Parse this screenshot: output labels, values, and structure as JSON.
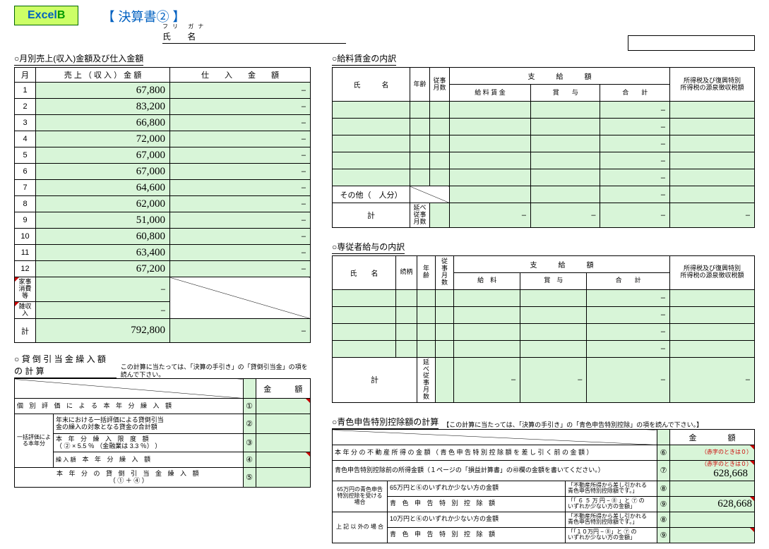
{
  "logo": {
    "part1": "Excel",
    "part2": "B"
  },
  "title": "【 決算書② 】",
  "furigana": "フリ  ガナ",
  "shimei": "氏   名",
  "monthly": {
    "title": "○月別売上(収入)金額及び仕入金額",
    "hdr_month": "月",
    "hdr_sales": "売 上 （ 収 入 ） 金 額",
    "hdr_purchase": "仕　　入　　金　　額",
    "rows": [
      {
        "m": "1",
        "s": "67,800",
        "p": "–"
      },
      {
        "m": "2",
        "s": "83,200",
        "p": "–"
      },
      {
        "m": "3",
        "s": "66,800",
        "p": "–"
      },
      {
        "m": "4",
        "s": "72,000",
        "p": "–"
      },
      {
        "m": "5",
        "s": "67,000",
        "p": "–"
      },
      {
        "m": "6",
        "s": "67,000",
        "p": "–"
      },
      {
        "m": "7",
        "s": "64,600",
        "p": "–"
      },
      {
        "m": "8",
        "s": "62,000",
        "p": "–"
      },
      {
        "m": "9",
        "s": "51,000",
        "p": "–"
      },
      {
        "m": "10",
        "s": "60,800",
        "p": "–"
      },
      {
        "m": "11",
        "s": "63,400",
        "p": "–"
      },
      {
        "m": "12",
        "s": "67,200",
        "p": "–"
      }
    ],
    "kaji": "家事消費等",
    "kaji_val": "–",
    "zatsu": "雑収入",
    "zatsu_val": "–",
    "kei": "計",
    "kei_sales": "792,800",
    "kei_purchase": "–"
  },
  "wages": {
    "title": "○給料賃金の内訳",
    "hdr_name": "氏　　　名",
    "hdr_age": "年齢",
    "hdr_months": "従事月数",
    "hdr_paygroup": "支　　　給　　　額",
    "hdr_pay1": "給 料 賃 金",
    "hdr_pay2": "賞　　与",
    "hdr_pay3": "合　　計",
    "hdr_tax1": "所得税及び復興特別",
    "hdr_tax2": "所得税の源泉徴収税額",
    "other": "その他（",
    "other_unit": "人分）",
    "kei": "計",
    "kei_months_lbl": "延べ従事月数",
    "dash": "–"
  },
  "fam": {
    "title": "○専従者給与の内訳",
    "hdr_name": "氏　　名",
    "hdr_rel": "続柄",
    "hdr_age": "年齢",
    "hdr_months": "従事月数",
    "hdr_paygroup": "支　　　給　　　額",
    "hdr_pay1": "給　料",
    "hdr_pay2": "賞　与",
    "hdr_pay3": "合　　計",
    "hdr_tax1": "所得税及び復興特別",
    "hdr_tax2": "所得税の源泉徴収税額",
    "kei": "計",
    "kei_months_lbl": "延べ従事月数",
    "dash": "–"
  },
  "bad": {
    "title": "○ 貸 倒 引 当 金 繰 入 額 の 計 算",
    "note": "この計算に当たっては、「決算の手引き」の「貸倒引当金」の項を読んで下さい。",
    "hdr_amt": "金　　　額",
    "r1": "個 別 評 価 に よ る 本 年 分 繰 入 額",
    "r2a": "年末における一括評価による貸倒引当",
    "r2b": "金の繰入の対象となる貸金の合計額",
    "r2left": "一括評価による本年分",
    "r3a": "本 年 分 繰 入 限 度 額",
    "r3b": "（ ② × 5.5 ％ （金融業は 3.3 ％） ）",
    "r4lbl": "繰 入 額",
    "r4": "本 年 分 繰 入 額",
    "r5a": "本 年 分 の 貸 倒 引 当 金 繰 入 額",
    "r5b": "（ ① ＋ ④ ）",
    "c1": "①",
    "c2": "②",
    "c3": "③",
    "c4": "④",
    "c5": "⑤"
  },
  "blue": {
    "title": "○青色申告特別控除額の計算",
    "note": "【この計算に当たっては、「決算の手引き」の「青色申告特別控除」の項を読んで下さい。】",
    "hdr_amt": "金　　　　額",
    "r6": "本 年 分 の 不 動 産 所 得 の 金 額 （ 青 色 申 告 特 別 控 除 額 を 差 し 引 く 前 の 金 額 ）",
    "r7": "青色申告特別控除前の所得金額（１ページの「損益計算書」の㊸欄の金額を書いてください。）",
    "r7v": "628,668",
    "r8left": "65万円の青色申告特別控除を受ける場合",
    "r8a": "65万円と⑥のいずれか少ない方の金額",
    "r8a_note1": "「不動産所得から差し引かれる",
    "r8a_note2": "青色申告特別控除額です。」",
    "r8b": "青 色 申 告 特 別 控 除 額",
    "r8b_note1": "「「 ６ ５ 万 円 − ⑧ 」と ⑦ の",
    "r8b_note2": "いずれか少ない方の金額」",
    "r9v": "628,668",
    "r9left": "上 記 以 外の 場 合",
    "r9a": "10万円と⑥のいずれか少ない方の金額",
    "r9a_note1": "「不動産所得から差し引かれる",
    "r9a_note2": "青色申告特別控除額です。」",
    "r9b": "青 色 申 告 特 別 控 除 額",
    "r9b_note1": "「「１０万円 − ⑧」と ⑦ の",
    "r9b_note2": "いずれか少ない方の金額」",
    "note6": "（赤字のときは０）",
    "note7": "（赤字のときは０）",
    "c6": "⑥",
    "c7": "⑦",
    "c8": "⑧",
    "c9": "⑨",
    "c10": "⑧",
    "c11": "⑨"
  }
}
